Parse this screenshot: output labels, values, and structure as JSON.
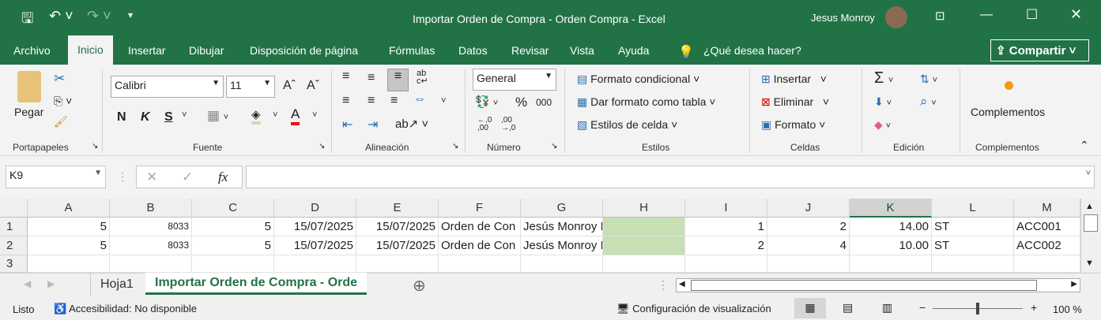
{
  "window": {
    "title": "Importar Orden de Compra - Orden Compra  -  Excel",
    "user": "Jesus Monroy"
  },
  "tabs": [
    "Archivo",
    "Inicio",
    "Insertar",
    "Dibujar",
    "Disposición de página",
    "Fórmulas",
    "Datos",
    "Revisar",
    "Vista",
    "Ayuda"
  ],
  "active_tab": "Inicio",
  "tell_me": "¿Qué desea hacer?",
  "share": "Compartir",
  "ribbon": {
    "clipboard": {
      "paste": "Pegar",
      "label": "Portapapeles"
    },
    "font": {
      "name": "Calibri",
      "size": "11",
      "bold": "N",
      "italic": "K",
      "underline": "S",
      "label": "Fuente",
      "fill_color": "#c6e0b4",
      "font_color": "#ff0000"
    },
    "alignment": {
      "label": "Alineación"
    },
    "number": {
      "format": "General",
      "label": "Número"
    },
    "styles": {
      "conditional": "Formato condicional",
      "table": "Dar formato como tabla",
      "cell_styles": "Estilos de celda",
      "label": "Estilos"
    },
    "cells": {
      "insert": "Insertar",
      "delete": "Eliminar",
      "format": "Formato",
      "label": "Celdas"
    },
    "editing": {
      "label": "Edición"
    },
    "addins": {
      "button": "Complementos",
      "label": "Complementos"
    }
  },
  "formula_bar": {
    "name_box": "K9",
    "fx": "fx",
    "value": ""
  },
  "columns": [
    "A",
    "B",
    "C",
    "D",
    "E",
    "F",
    "G",
    "H",
    "I",
    "J",
    "K",
    "L",
    "M"
  ],
  "selected_column": "K",
  "rows": [
    {
      "n": "1",
      "cells": [
        "5",
        "8033",
        "5",
        "15/07/2025",
        "15/07/2025",
        "Orden de Con",
        "Jesús Monroy I",
        "",
        "1",
        "2",
        "14.00",
        "ST",
        "ACC001"
      ]
    },
    {
      "n": "2",
      "cells": [
        "5",
        "8033",
        "5",
        "15/07/2025",
        "15/07/2025",
        "Orden de Con",
        "Jesús Monroy I",
        "",
        "2",
        "4",
        "10.00",
        "ST",
        "ACC002"
      ]
    },
    {
      "n": "3",
      "cells": [
        "",
        "",
        "",
        "",
        "",
        "",
        "",
        "",
        "",
        "",
        "",
        "",
        ""
      ]
    }
  ],
  "sheets": [
    "Hoja1",
    "Importar Orden de Compra - Orde"
  ],
  "active_sheet": "Importar Orden de Compra - Orde",
  "status": {
    "ready": "Listo",
    "accessibility": "Accesibilidad: No disponible",
    "display": "Configuración de visualización",
    "zoom": "100 %",
    "zoom_minus": "−",
    "zoom_plus": "+"
  },
  "colors": {
    "brand": "#217346",
    "highlight": "#c6e0b4"
  }
}
